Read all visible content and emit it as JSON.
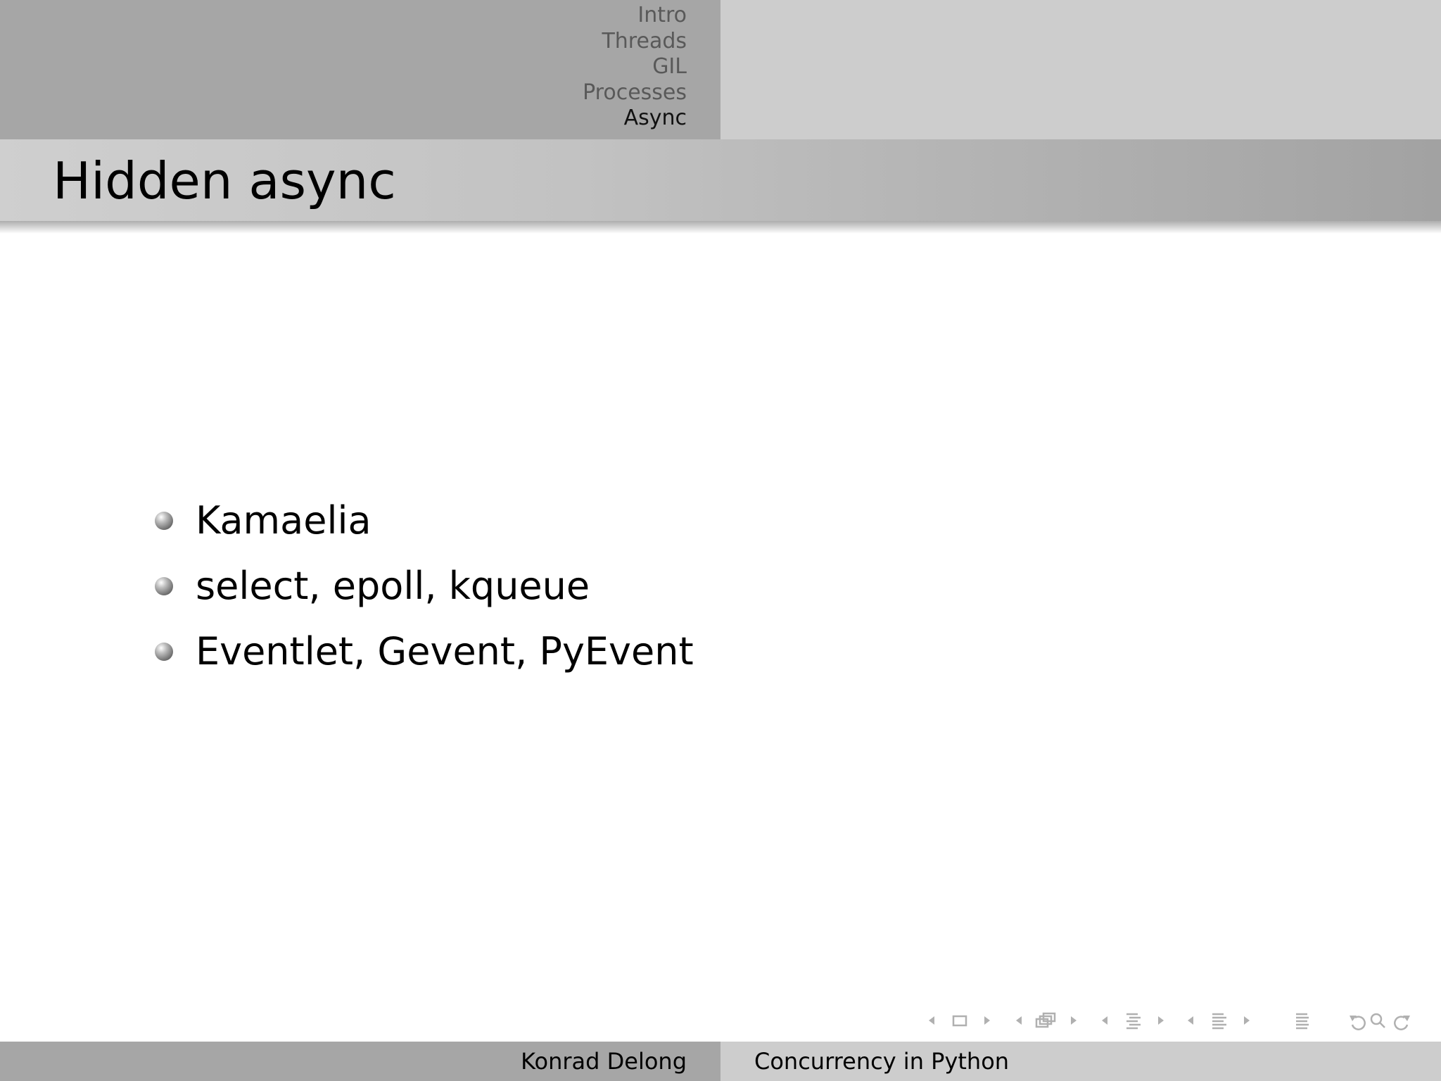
{
  "header": {
    "sections": [
      "Intro",
      "Threads",
      "GIL",
      "Processes",
      "Async"
    ],
    "current_section": "Async"
  },
  "frame": {
    "title": "Hidden async",
    "items": [
      "Kamaelia",
      "select, epoll, kqueue",
      "Eventlet, Gevent, PyEvent"
    ]
  },
  "footer": {
    "author": "Konrad Delong",
    "title": "Concurrency in Python"
  },
  "nav_symbols": [
    "prev-slide-arrow-icon",
    "slide-icon",
    "next-slide-arrow-icon",
    "prev-frame-arrow-icon",
    "frame-icon",
    "next-frame-arrow-icon",
    "prev-subsection-arrow-icon",
    "subsection-icon",
    "next-subsection-arrow-icon",
    "prev-section-arrow-icon",
    "section-icon",
    "next-section-arrow-icon",
    "document-icon",
    "back-icon",
    "search-icon",
    "forward-icon"
  ],
  "colors": {
    "header_left": "#a6a6a6",
    "header_right": "#cdcdcd",
    "nav_inactive": "#595959",
    "nav_active": "#111111",
    "nav_icon": "#b0b0b0"
  }
}
